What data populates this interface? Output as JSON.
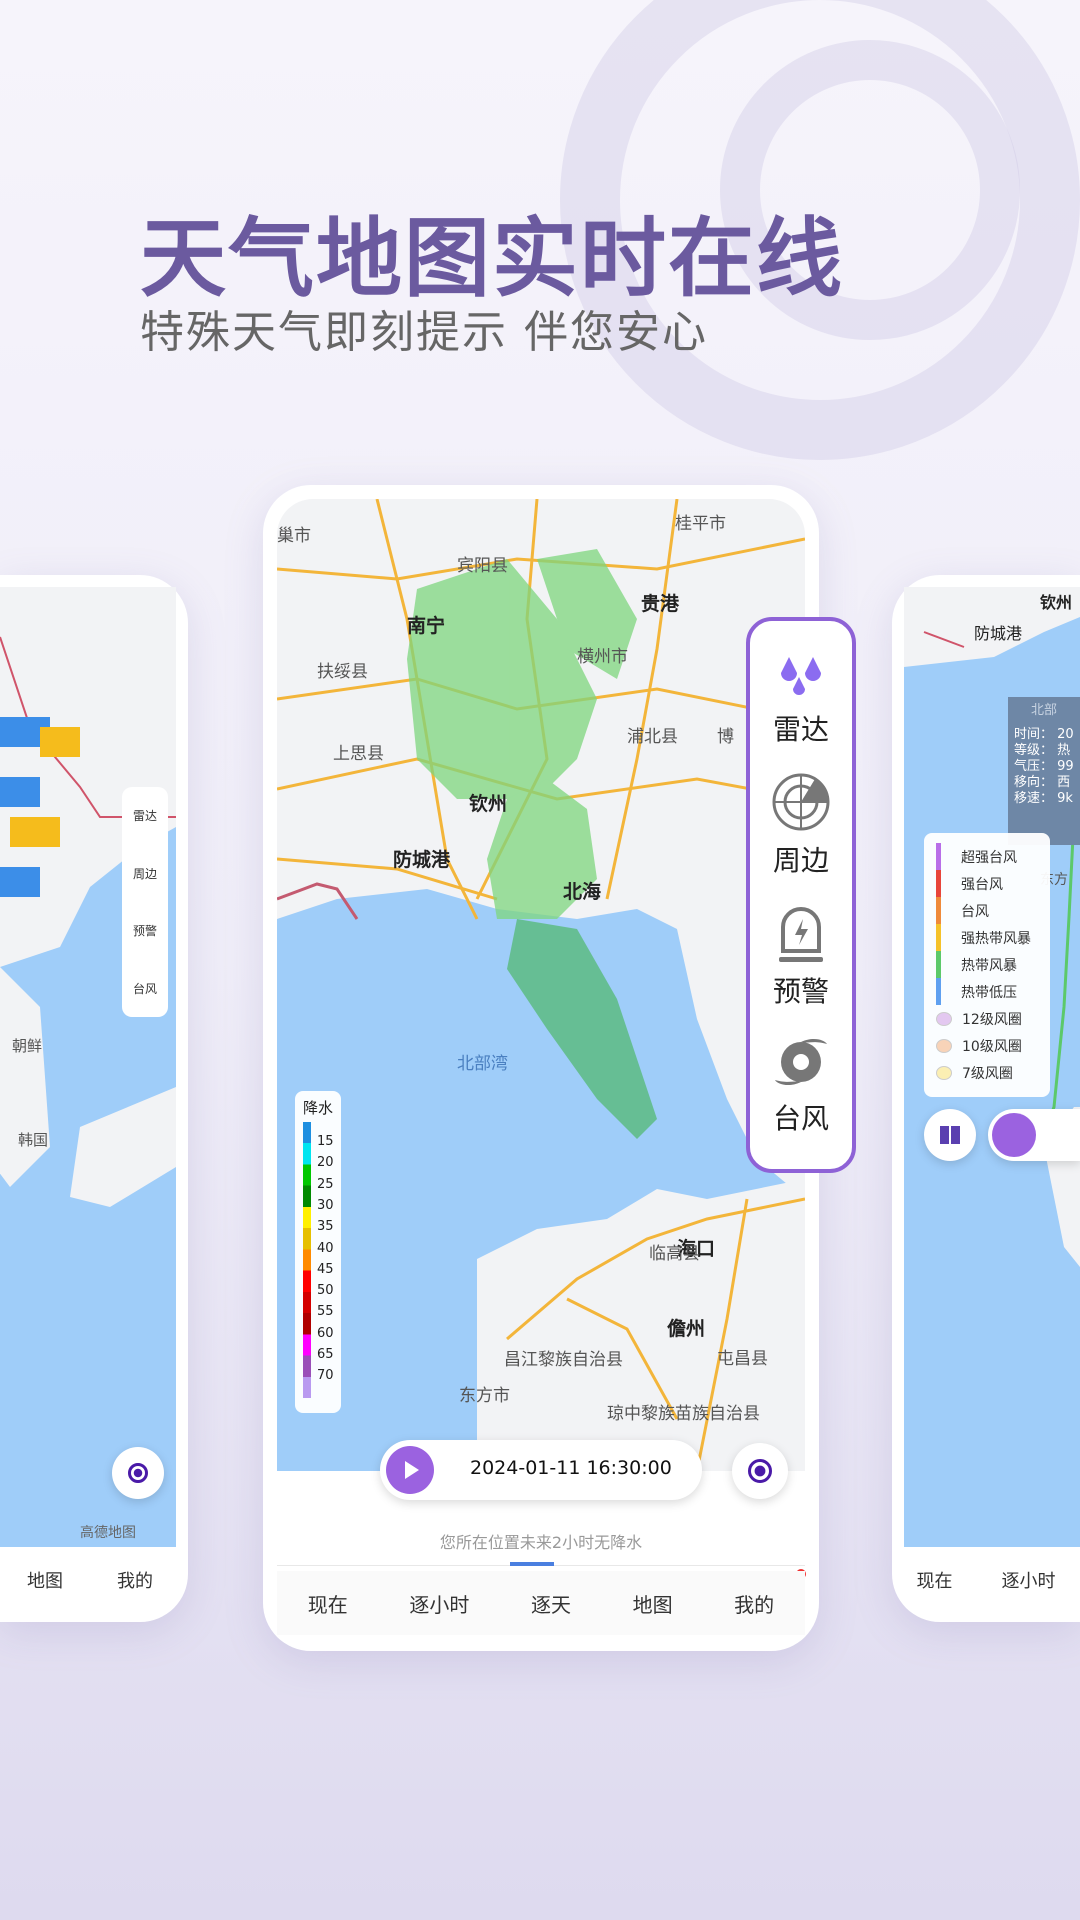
{
  "header": {
    "title": "天气地图实时在线",
    "subtitle": "特殊天气即刻提示  伴您安心"
  },
  "colors": {
    "accent": "#8e62d6",
    "title": "#6b5a9f",
    "sea": "#9fcdf9",
    "radar": "#7ed67e"
  },
  "center": {
    "map_labels": [
      "巢市",
      "宾阳县",
      "桂平市",
      "贵港",
      "南宁",
      "扶绥县",
      "横州市",
      "浦北县",
      "博",
      "上思县",
      "钦州",
      "防城港",
      "北海",
      "北部湾",
      "海口",
      "临高县",
      "儋州",
      "屯昌县",
      "昌江黎族自治县",
      "东方市",
      "琼中黎族苗族自治县"
    ],
    "panel": [
      {
        "icon": "rain-drops-icon",
        "label": "雷达"
      },
      {
        "icon": "radar-scan-icon",
        "label": "周边"
      },
      {
        "icon": "warning-light-icon",
        "label": "预警"
      },
      {
        "icon": "typhoon-icon",
        "label": "台风"
      }
    ],
    "legend": {
      "title": "降水",
      "ticks": [
        "15",
        "20",
        "25",
        "30",
        "35",
        "40",
        "45",
        "50",
        "55",
        "60",
        "65",
        "70"
      ],
      "colors": [
        "#1e8fe0",
        "#00e5f0",
        "#00c800",
        "#008a00",
        "#fff000",
        "#e6c000",
        "#ff8a00",
        "#ff0000",
        "#d40000",
        "#b00000",
        "#ff00ff",
        "#9a4fb8",
        "#b99af0"
      ]
    },
    "playbar": {
      "time": "2024-01-11 16:30:00"
    },
    "status": "您所在位置未来2小时无降水",
    "tabs": [
      "现在",
      "逐小时",
      "逐天",
      "地图",
      "我的"
    ],
    "active_tab": 3
  },
  "left": {
    "map_labels": [
      "朝鲜",
      "韩国"
    ],
    "panel": [
      "雷达",
      "周边",
      "预警",
      "台风"
    ],
    "attribution": "高德地图",
    "tabs": [
      "地图",
      "我的"
    ]
  },
  "right": {
    "map_labels": [
      "钦州",
      "防城港",
      "东方"
    ],
    "info": {
      "title": "北部",
      "rows": [
        "时间： 20",
        "等级： 热",
        "气压： 99",
        "移向： 西",
        "移速： 9k"
      ]
    },
    "legend": [
      {
        "label": "超强台风",
        "color": "#b86ee8"
      },
      {
        "label": "强台风",
        "color": "#e8453a"
      },
      {
        "label": "台风",
        "color": "#ef8a3a"
      },
      {
        "label": "强热带风暴",
        "color": "#f5c22a"
      },
      {
        "label": "热带风暴",
        "color": "#5cc96a"
      },
      {
        "label": "热带低压",
        "color": "#5fa0f0"
      }
    ],
    "circles": [
      {
        "label": "12级风圈",
        "color": "#e3c8f0"
      },
      {
        "label": "10级风圈",
        "color": "#f8d3b8"
      },
      {
        "label": "7级风圈",
        "color": "#fbefb3"
      }
    ],
    "tabs": [
      "现在",
      "逐小时"
    ]
  }
}
